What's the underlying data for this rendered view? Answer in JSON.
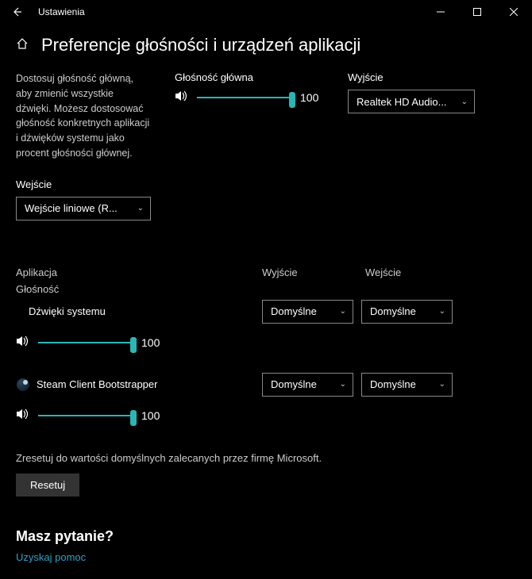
{
  "window": {
    "title": "Ustawienia"
  },
  "header": {
    "title": "Preferencje głośności i urządzeń aplikacji"
  },
  "description": "Dostosuj głośność główną, aby zmienić wszystkie dźwięki. Możesz dostosować głośność konkretnych aplikacji i dźwięków systemu jako procent głośności głównej.",
  "master": {
    "label": "Głośność główna",
    "value": "100",
    "percent": 100
  },
  "output": {
    "label": "Wyjście",
    "selected": "Realtek HD Audio..."
  },
  "input": {
    "label": "Wejście",
    "selected": "Wejście liniowe (R..."
  },
  "columns": {
    "app": "Aplikacja",
    "output": "Wyjście",
    "input": "Wejście",
    "volume": "Głośność"
  },
  "apps": [
    {
      "name": "Dźwięki systemu",
      "icon": "system",
      "value": "100",
      "percent": 100,
      "output": "Domyślne",
      "input": "Domyślne"
    },
    {
      "name": "Steam Client Bootstrapper",
      "icon": "steam",
      "value": "100",
      "percent": 100,
      "output": "Domyślne",
      "input": "Domyślne"
    }
  ],
  "reset": {
    "text": "Zresetuj do wartości domyślnych zalecanych przez firmę Microsoft.",
    "button": "Resetuj"
  },
  "help": {
    "title": "Masz pytanie?",
    "link": "Uzyskaj pomoc"
  }
}
